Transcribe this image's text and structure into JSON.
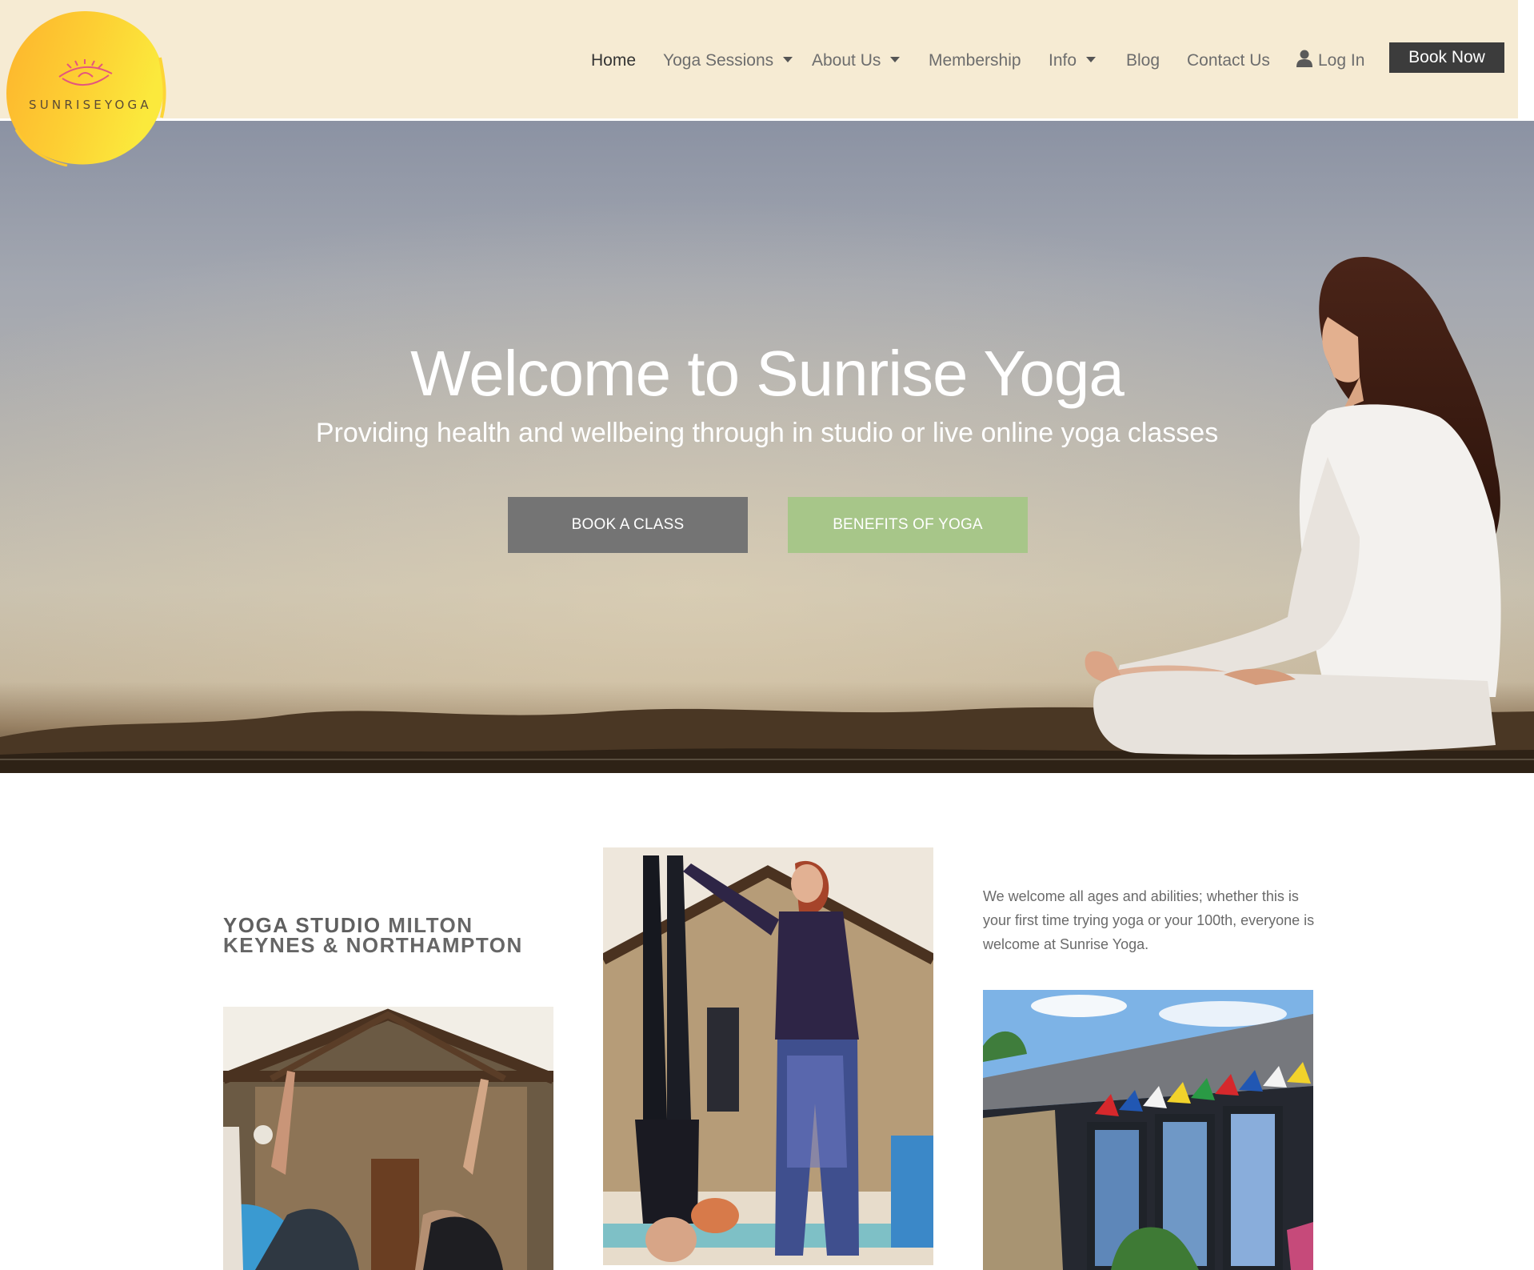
{
  "brand": {
    "logo_text_part1": "SUNRISE",
    "logo_text_part2": "YOGA",
    "logo_color": "#fcd535",
    "header_bg": "#f6ebd3"
  },
  "nav": {
    "home": "Home",
    "yoga_sessions": "Yoga Sessions",
    "about_us": "About Us",
    "membership": "Membership",
    "info": "Info",
    "blog": "Blog",
    "contact_us": "Contact Us",
    "log_in": "Log In",
    "book_now": "Book Now"
  },
  "hero": {
    "title": "Welcome to Sunrise Yoga",
    "subtitle": "Providing health and wellbeing through in studio or live online yoga classes",
    "book_class_label": "BOOK A CLASS",
    "benefits_label": "BENEFITS OF YOGA",
    "book_class_color": "#747474",
    "benefits_color": "#a7c689"
  },
  "content": {
    "heading_bold": "YOGA STUDIO",
    "heading_rest": " MILTON KEYNES & NORTHAMPTON",
    "welcome_text": "We welcome all ages and abilities; whether this is your first time trying yoga or your 100th, everyone is welcome at Sunrise Yoga."
  },
  "icons": {
    "user": "user-icon",
    "caret": "caret-down-icon"
  }
}
